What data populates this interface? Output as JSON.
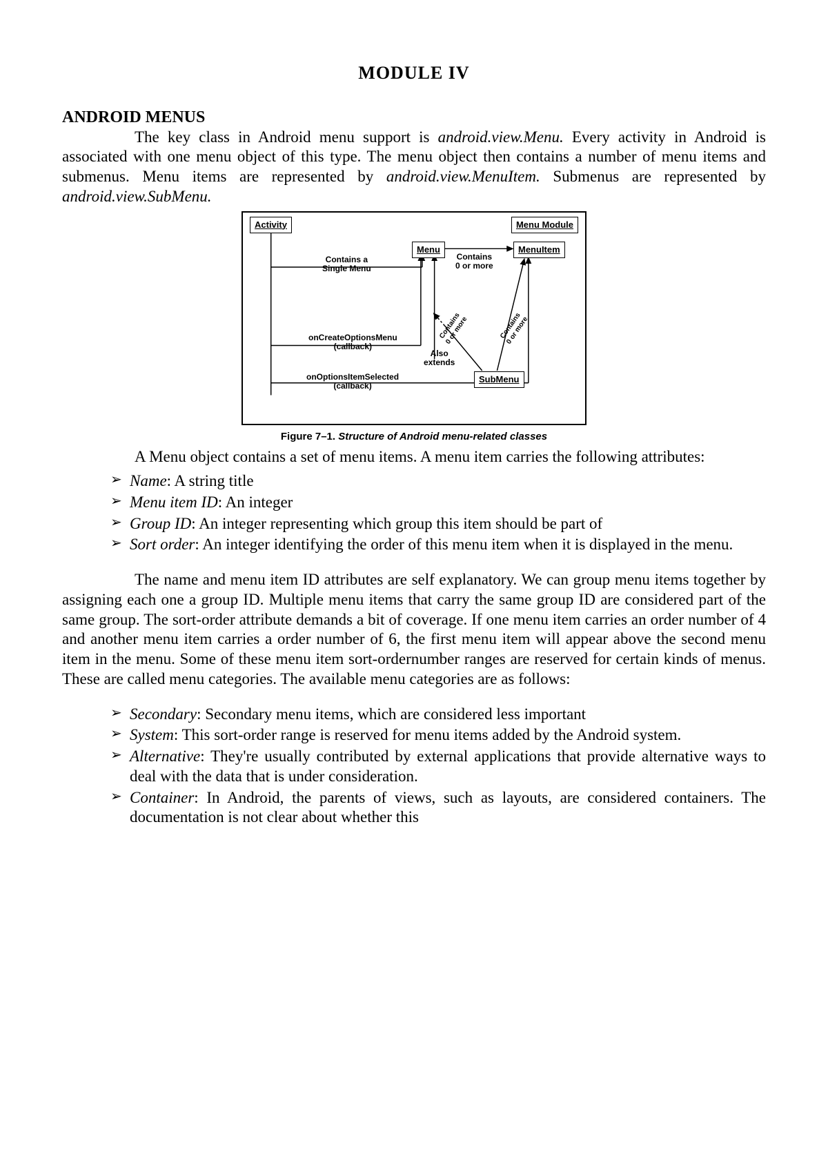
{
  "title": "MODULE  IV",
  "heading": "ANDROID MENUS",
  "intro": {
    "pre": "The key class in Android menu support is ",
    "class1": "android.view.Menu.",
    "mid1": " Every activity in Android is associated with one menu object of this type. The menu object then contains a number of menu items and submenus. Menu items are represented by ",
    "class2": "android.view.MenuItem.",
    "mid2": " Submenus are represented by ",
    "class3": "android.view.SubMenu."
  },
  "diagram": {
    "activity": "Activity",
    "menuModule": "Menu Module",
    "menu": "Menu",
    "menuItem": "MenuItem",
    "subMenu": "SubMenu",
    "containsSingle": "Contains a\nSingle Menu",
    "containsZeroMore": "Contains\n0 or more",
    "onCreate": "onCreateOptionsMenu\n(callback)",
    "onSelected": "onOptionsItemSelected\n(callback)",
    "alsoExtends": "Also\nextends",
    "rot1": "Contains\n0 or more",
    "rot2": "Contains\n0 or more"
  },
  "figCaption": {
    "label": "Figure 7–1. ",
    "desc": "Structure of Android menu-related classes"
  },
  "para2": "A Menu object contains a set of menu items. A menu item carries the following attributes:",
  "list1": [
    {
      "term": "Name",
      "desc": ": A string title"
    },
    {
      "term": "Menu item ID",
      "desc": ": An integer"
    },
    {
      "term": "Group ID",
      "desc": ": An integer representing which group this item should be part of"
    },
    {
      "term": "Sort order",
      "desc": ": An integer identifying the order of this menu item when it is displayed in the menu."
    }
  ],
  "para3": "The name and menu item ID attributes are self explanatory. We can group menu items together by assigning each one a group ID. Multiple menu items that carry the same group ID are considered part of the same group. The sort-order attribute demands a bit of coverage. If one menu item carries an order number of 4 and another menu item carries a order number of 6, the first menu item will appear above the second menu item in the menu. Some of these menu item sort-ordernumber ranges are reserved for certain kinds of menus. These are called menu categories. The available menu categories are as follows:",
  "list2": [
    {
      "term": "Secondary",
      "desc": ": Secondary menu items, which are considered less important"
    },
    {
      "term": "System",
      "desc": ": This sort-order range is reserved for menu items added by the Android system."
    },
    {
      "term": "Alternative",
      "desc": ": They're usually contributed by external applications that provide alternative ways to deal with the data that is under consideration."
    },
    {
      "term": "Container",
      "desc": ": In Android, the parents of views, such as layouts, are considered containers. The documentation is not clear about whether this"
    }
  ]
}
